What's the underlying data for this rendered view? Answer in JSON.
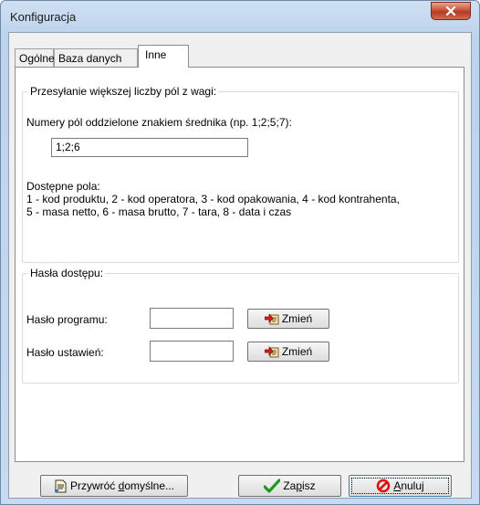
{
  "window": {
    "title": "Konfiguracja",
    "close_label": "X"
  },
  "tabs": [
    {
      "label": "Ogólne",
      "active": false
    },
    {
      "label": "Baza danych",
      "active": false
    },
    {
      "label": "Inne",
      "active": true
    }
  ],
  "group_fields": {
    "legend": "Przesyłanie większej liczby pól z wagi:",
    "prompt": "Numery pól oddzielone znakiem średnika (np. 1;2;5;7):",
    "value": "1;2;6",
    "available_title": "Dostępne pola:",
    "available_line1": "1 - kod produktu, 2 - kod operatora, 3 - kod opakowania, 4 - kod kontrahenta,",
    "available_line2": "5 - masa netto, 6 - masa brutto, 7 - tara, 8 - data i czas"
  },
  "group_passwords": {
    "legend": "Hasła dostępu:",
    "program_label": "Hasło programu:",
    "program_value": "",
    "settings_label": "Hasło ustawień:",
    "settings_value": "",
    "change_label": "Zmień"
  },
  "footer": {
    "restore_pre": "Przywróć ",
    "restore_accel": "d",
    "restore_post": "omyślne...",
    "save_pre": "Za",
    "save_accel": "p",
    "save_post": "isz",
    "cancel_accel": "A",
    "cancel_post": "nuluj"
  },
  "icons": {
    "close": "close-x-icon",
    "change": "change-key-icon",
    "restore": "document-restore-icon",
    "save": "green-check-icon",
    "cancel": "red-cancel-icon"
  }
}
